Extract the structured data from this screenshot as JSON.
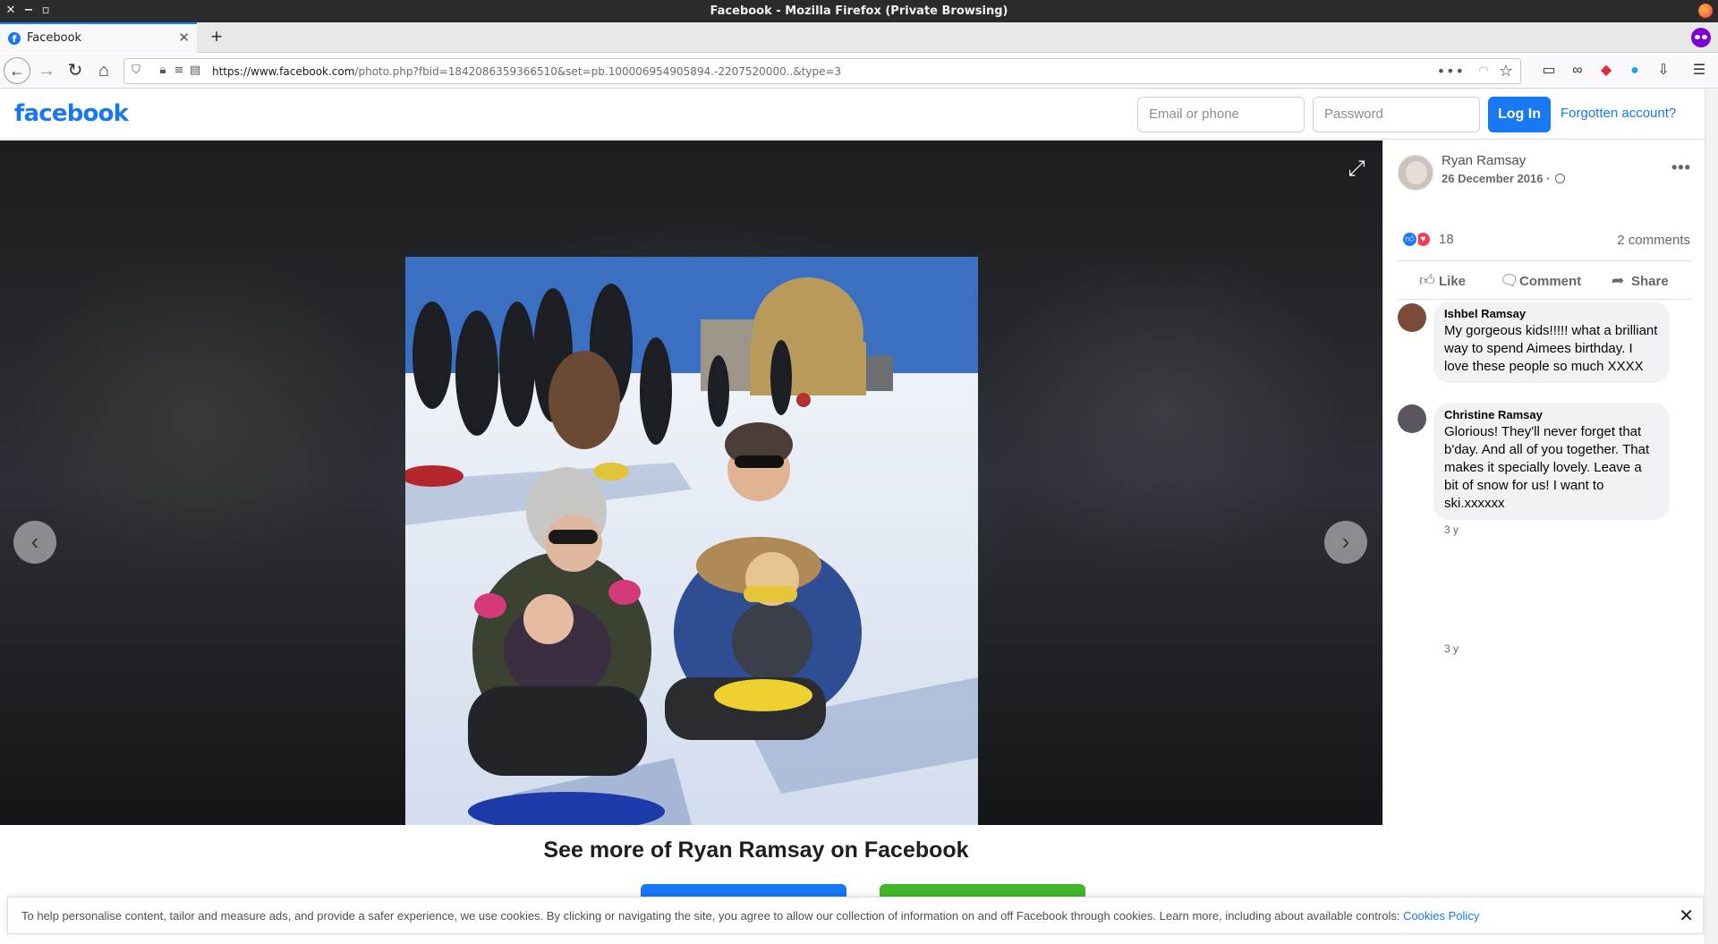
{
  "window": {
    "title": "Facebook - Mozilla Firefox (Private Browsing)",
    "controls": [
      "close-icon",
      "minimize-icon",
      "maximize-icon"
    ]
  },
  "tabs": [
    {
      "label": "Facebook",
      "favicon": "f"
    }
  ],
  "nav": {
    "url_host": "https://www.facebook.com",
    "url_path": "/photo.php?fbid=1842086359366510&set=pb.100006954905894.-2207520000..&type=3"
  },
  "header": {
    "logo": "facebook",
    "email_placeholder": "Email or phone",
    "password_placeholder": "Password",
    "login_label": "Log In",
    "forgot_label": "Forgotten account?"
  },
  "post": {
    "author": "Ryan Ramsay",
    "date": "26 December 2016 ·",
    "reaction_count": "18",
    "comment_count": "2 comments",
    "actions": {
      "like": "Like",
      "comment": "Comment",
      "share": "Share"
    }
  },
  "comments": [
    {
      "name": "Ishbel Ramsay",
      "text": "My gorgeous kids!!!!! what a brilliant way to spend Aimees birthday. I love these people so much XXXX",
      "time": "3 y"
    },
    {
      "name": "Christine Ramsay",
      "text": "Glorious! They'll never forget that b'day. And all of you together. That makes it specially lovely. Leave a bit of snow for us! I want to ski.xxxxxx",
      "time": "3 y"
    }
  ],
  "see_more": "See more of Ryan Ramsay on Facebook",
  "cookie": {
    "text": "To help personalise content, tailor and measure ads, and provide a safer experience, we use cookies. By clicking or navigating the site, you agree to allow our collection of information on and off Facebook through cookies. Learn more, including about available controls: ",
    "link": "Cookies Policy"
  },
  "colors": {
    "brand": "#1877f2",
    "create_green": "#42b72a",
    "private_purple": "#8000d7"
  }
}
